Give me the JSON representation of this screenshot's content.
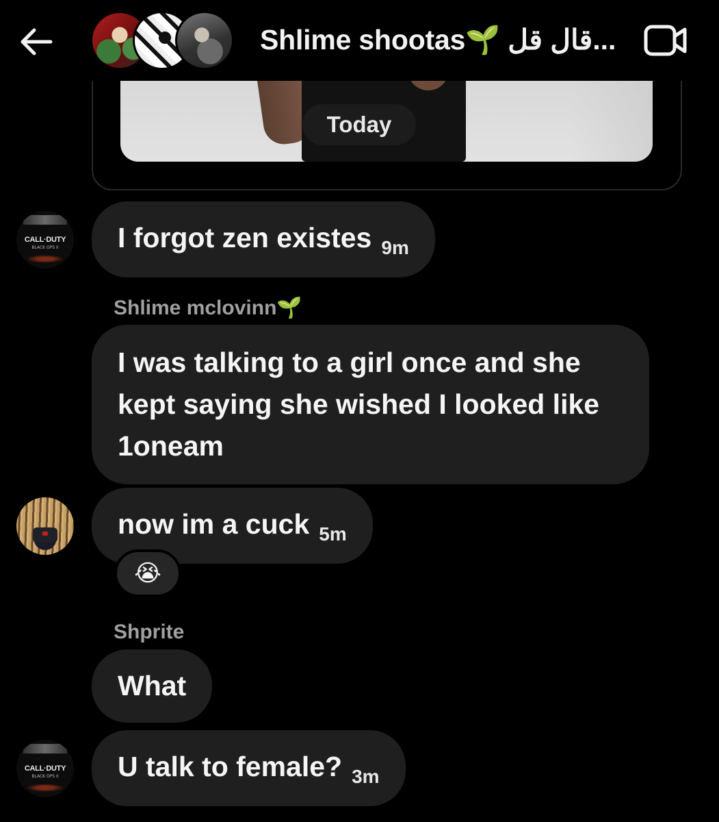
{
  "header": {
    "back_icon": "arrow-left-icon",
    "title": "Shlime shootas🌱 قال قل...",
    "video_icon": "video-camera-icon"
  },
  "media": {
    "date_label": "Today"
  },
  "messages": [
    {
      "avatar": "call-of-duty-black-ops-avatar",
      "avatar_text": "CALL·DUTY",
      "avatar_sub": "BLACK OPS II",
      "text": "I forgot zen existes",
      "time": "9m"
    },
    {
      "sender": "Shlime mclovinn🌱",
      "text": "I was talking to a girl once and she kept saying she wished I looked like 1oneam"
    },
    {
      "avatar": "dreadlocks-masked-avatar",
      "text": "now im a cuck",
      "time": "5m",
      "reaction": "😭"
    },
    {
      "sender": "Shprite",
      "text": "What"
    },
    {
      "avatar": "call-of-duty-black-ops-avatar",
      "avatar_text": "CALL·DUTY",
      "avatar_sub": "BLACK OPS II",
      "text": "U talk to female?",
      "time": "3m"
    }
  ],
  "colors": {
    "background": "#000000",
    "bubble": "#1f1f1f",
    "sender_name": "#a0a0a0",
    "text": "#f5f5f5"
  }
}
